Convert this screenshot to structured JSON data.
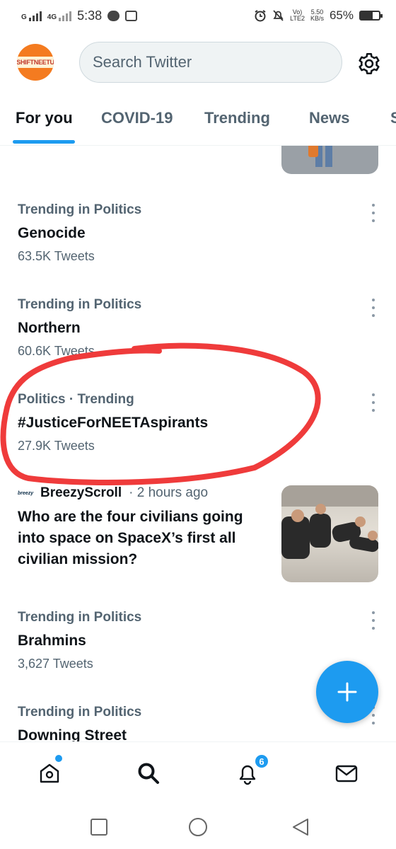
{
  "status_bar": {
    "net_a": "G",
    "net_b": "4G",
    "time": "5:38",
    "volte_top": "Vo)",
    "volte_bottom": "LTE2",
    "speed_top": "5.50",
    "speed_bottom": "KB/s",
    "battery": "65%",
    "battery_level": 0.65
  },
  "header": {
    "avatar_text": "SHIFTNEETU",
    "search_placeholder": "Search Twitter"
  },
  "tabs": [
    {
      "label": "For you",
      "active": true
    },
    {
      "label": "COVID-19",
      "active": false
    },
    {
      "label": "Trending",
      "active": false
    },
    {
      "label": "News",
      "active": false
    },
    {
      "label": "S",
      "active": false
    }
  ],
  "trends": [
    {
      "meta": "Trending in Politics",
      "name": "Genocide",
      "count": "63.5K Tweets"
    },
    {
      "meta": "Trending in Politics",
      "name": "Northern",
      "count": "60.6K Tweets"
    },
    {
      "meta": "Politics · Trending",
      "name": "#JusticeForNEETAspirants",
      "count": "27.9K Tweets"
    },
    {
      "meta": "Trending in Politics",
      "name": "Brahmins",
      "count": "3,627 Tweets"
    },
    {
      "meta": "Trending in Politics",
      "name": "Downing Street",
      "count": ""
    }
  ],
  "news": {
    "logo_text": "breezy",
    "source": "BreezyScroll",
    "time": "· 2 hours ago",
    "headline": "Who are the four civilians going into space on SpaceX’s first all civilian mission?"
  },
  "bottom_nav": {
    "notifications_badge": "6"
  },
  "colors": {
    "accent": "#1d9bf0",
    "annotation": "#ef3b3b"
  }
}
